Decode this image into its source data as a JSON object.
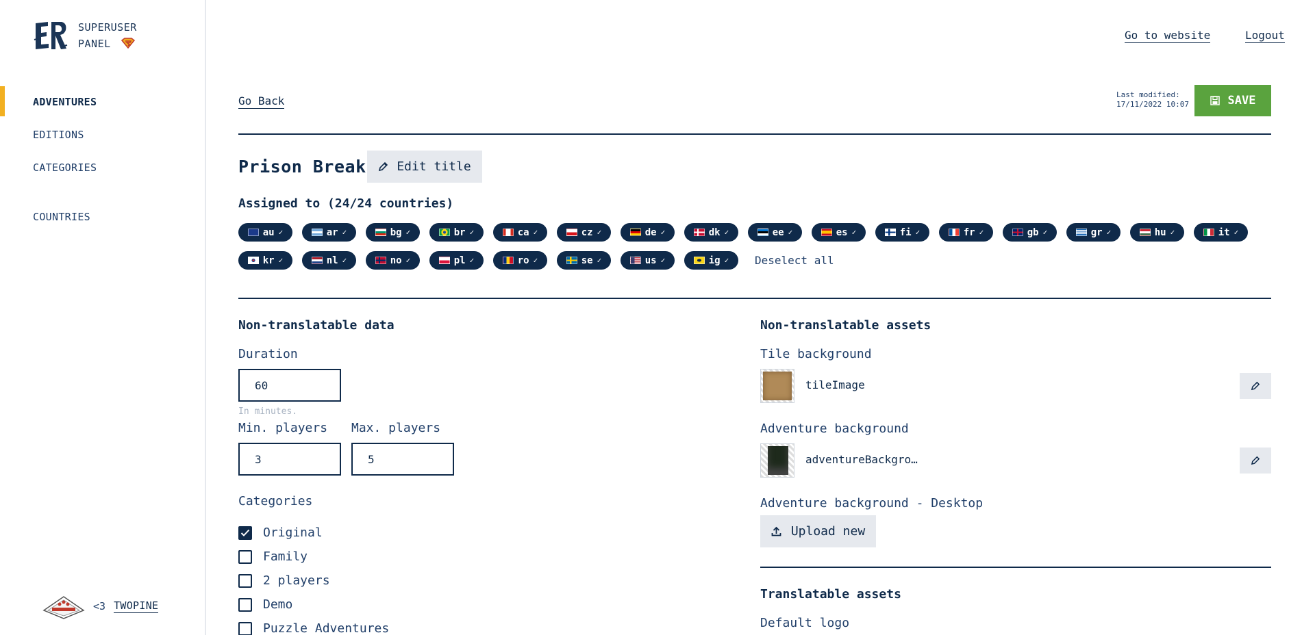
{
  "sidebar": {
    "brand_line1": "SUPERUSER",
    "brand_line2": "PANEL",
    "brand_icon": "superman-icon",
    "nav": [
      {
        "label": "ADVENTURES",
        "active": true
      },
      {
        "label": "EDITIONS"
      },
      {
        "label": "CATEGORIES"
      },
      {
        "label": "COUNTRIES"
      }
    ],
    "footer_heart": "<3",
    "footer_link": "TWOPINE",
    "accent_color": "#f2b021"
  },
  "top": {
    "go_to_website": "Go to website",
    "logout": "Logout"
  },
  "editor": {
    "go_back": "Go Back",
    "last_modified_label": "Last modified:",
    "last_modified_value": "17/11/2022 10:07",
    "save_label": "SAVE",
    "save_color": "#5aa33e",
    "title": "Prison Break",
    "edit_title_label": "Edit title",
    "assigned_text": "Assigned to (24/24 countries)",
    "countries_row1": [
      "au",
      "ar",
      "bg",
      "br",
      "ca",
      "cz",
      "de",
      "dk",
      "ee",
      "es",
      "fi",
      "fr",
      "gb",
      "gr",
      "hu",
      "it"
    ],
    "countries_row2": [
      "kr",
      "nl",
      "no",
      "pl",
      "ro",
      "se",
      "us",
      "ig"
    ],
    "deselect_all": "Deselect all"
  },
  "non_translatable_data": {
    "title": "Non-translatable data",
    "duration_label": "Duration",
    "duration_value": "60",
    "duration_hint": "In minutes.",
    "min_players_label": "Min. players",
    "min_players_value": "3",
    "max_players_label": "Max. players",
    "max_players_value": "5",
    "categories_label": "Categories",
    "categories": [
      {
        "label": "Original",
        "checked": true
      },
      {
        "label": "Family",
        "checked": false
      },
      {
        "label": "2 players",
        "checked": false
      },
      {
        "label": "Demo",
        "checked": false
      },
      {
        "label": "Puzzle Adventures",
        "checked": false
      }
    ]
  },
  "non_translatable_assets": {
    "title": "Non-translatable assets",
    "tile_background_label": "Tile background",
    "tile_background_file": "tileImage",
    "adventure_background_label": "Adventure background",
    "adventure_background_file": "adventureBackgro…",
    "adventure_background_desktop_label": "Adventure background - Desktop",
    "upload_new_label": "Upload new"
  },
  "translatable_assets": {
    "title": "Translatable assets",
    "default_logo_label": "Default logo"
  },
  "colors": {
    "navy": "#0f2a4a",
    "chip_bg": "#0f2a4a",
    "button_grey": "#e6e9ee"
  }
}
